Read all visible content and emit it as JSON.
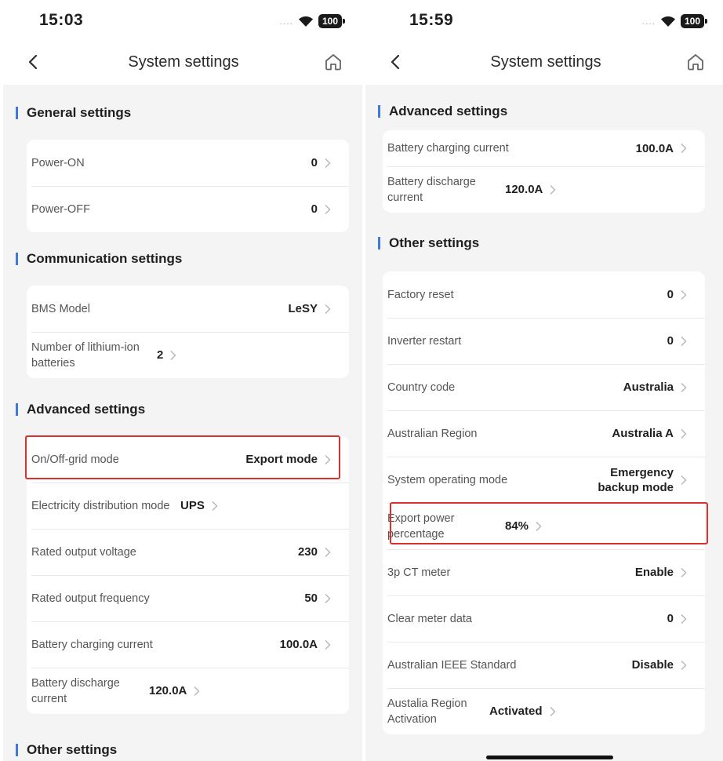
{
  "left": {
    "status": {
      "time": "15:03",
      "battery": "100"
    },
    "nav": {
      "title": "System settings"
    },
    "sections": [
      {
        "title": "General settings",
        "rows": [
          {
            "label": "Power-ON",
            "value": "0"
          },
          {
            "label": "Power-OFF",
            "value": "0"
          }
        ]
      },
      {
        "title": "Communication settings",
        "rows": [
          {
            "label": "BMS Model",
            "value": "LeSY"
          },
          {
            "label": "Number of lithium-ion batteries",
            "value": "2"
          }
        ]
      },
      {
        "title": "Advanced settings",
        "rows": [
          {
            "label": "On/Off-grid mode",
            "value": "Export mode"
          },
          {
            "label": "Electricity distribution mode",
            "value": "UPS"
          },
          {
            "label": "Rated output voltage",
            "value": "230"
          },
          {
            "label": "Rated output frequency",
            "value": "50"
          },
          {
            "label": "Battery charging current",
            "value": "100.0A"
          },
          {
            "label": "Battery discharge current",
            "value": "120.0A"
          }
        ]
      },
      {
        "title": "Other settings",
        "rows": []
      }
    ]
  },
  "right": {
    "status": {
      "time": "15:59",
      "battery": "100"
    },
    "nav": {
      "title": "System settings"
    },
    "sections": [
      {
        "title": "Advanced settings",
        "rows": [
          {
            "label": "Battery charging current",
            "value": "100.0A"
          },
          {
            "label": "Battery discharge current",
            "value": "120.0A"
          }
        ]
      },
      {
        "title": "Other settings",
        "rows": [
          {
            "label": "Factory reset",
            "value": "0"
          },
          {
            "label": "Inverter restart",
            "value": "0"
          },
          {
            "label": "Country code",
            "value": "Australia"
          },
          {
            "label": "Australian Region",
            "value": "Australia A"
          },
          {
            "label": "System operating mode",
            "value": "Emergency backup mode"
          },
          {
            "label": "Export power percentage",
            "value": "84%"
          },
          {
            "label": "3p CT meter",
            "value": "Enable"
          },
          {
            "label": "Clear meter data",
            "value": "0"
          },
          {
            "label": "Australian IEEE Standard",
            "value": "Disable"
          },
          {
            "label": "Austalia Region Activation",
            "value": "Activated"
          }
        ]
      }
    ]
  },
  "icons": {
    "back": "chevron-left-icon",
    "home": "home-icon",
    "row_arrow": "chevron-right-icon",
    "wifi": "wifi-icon",
    "battery": "battery-icon"
  },
  "colors": {
    "section_accent": "#3f7bd6",
    "highlight": "#d93030",
    "background": "#f4f4f5",
    "card": "#ffffff"
  }
}
